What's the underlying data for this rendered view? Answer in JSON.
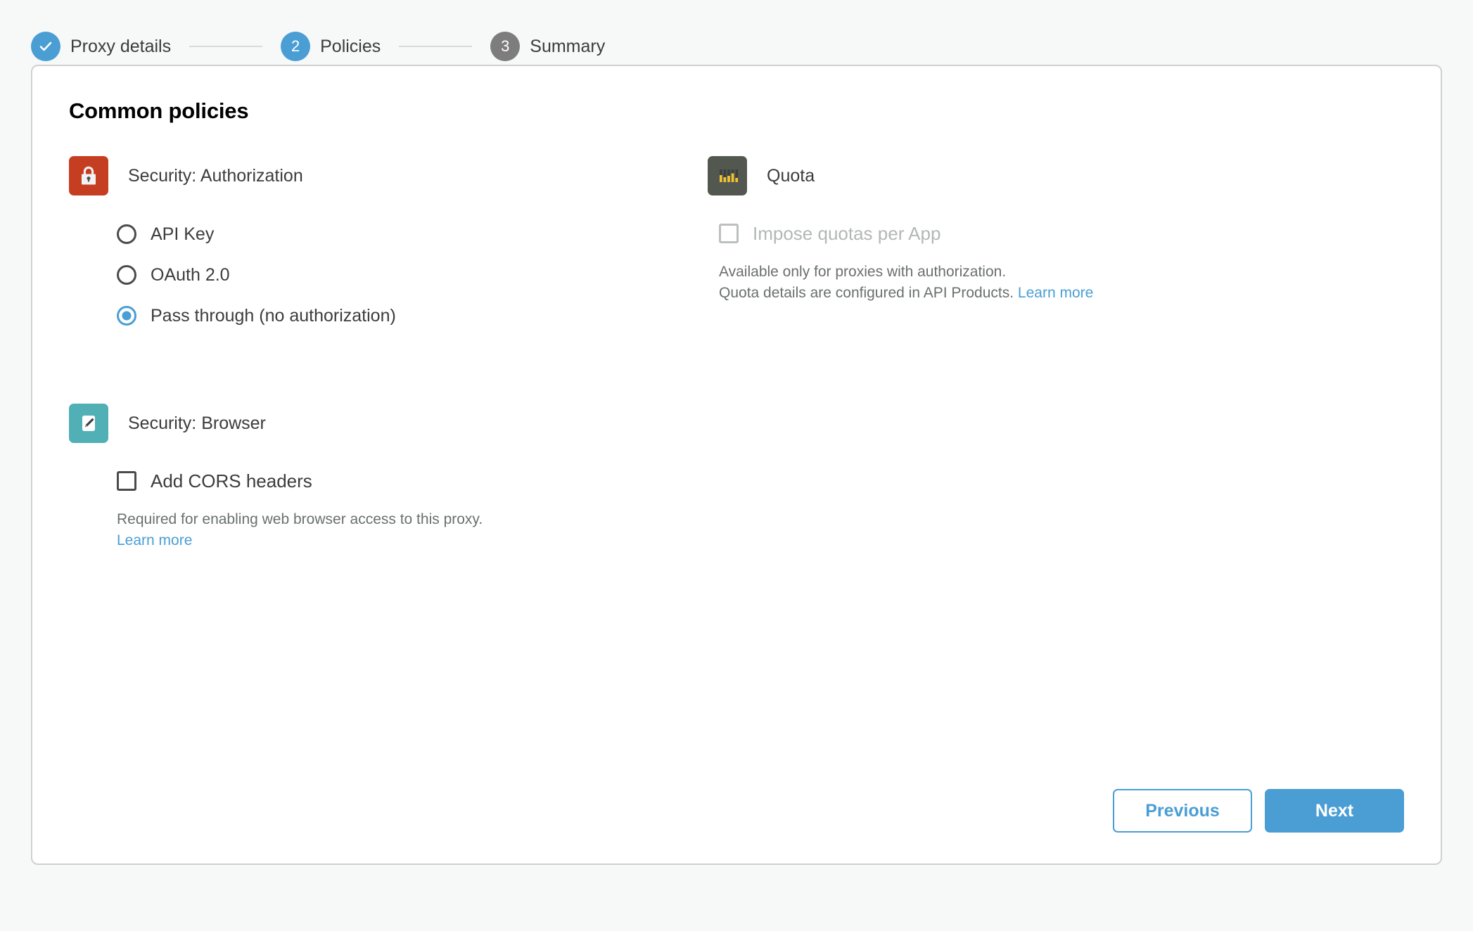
{
  "stepper": {
    "steps": [
      {
        "id": "proxy-details",
        "badge": "check-icon",
        "label": "Proxy details",
        "state": "done"
      },
      {
        "id": "policies",
        "badge": "2",
        "label": "Policies",
        "state": "active"
      },
      {
        "id": "summary",
        "badge": "3",
        "label": "Summary",
        "state": "todo"
      }
    ]
  },
  "card": {
    "title": "Common policies",
    "policies": {
      "security_authorization": {
        "icon": "lock-icon",
        "name": "Security: Authorization",
        "options": [
          {
            "label": "API Key",
            "selected": false
          },
          {
            "label": "OAuth 2.0",
            "selected": false
          },
          {
            "label": "Pass through (no authorization)",
            "selected": true
          }
        ]
      },
      "security_browser": {
        "icon": "pencil-icon",
        "name": "Security: Browser",
        "checkbox_label": "Add CORS headers",
        "checked": false,
        "helper_line1": "Required for enabling web browser access to this proxy.",
        "learn_more": "Learn more"
      },
      "quota": {
        "icon": "quota-bars-icon",
        "name": "Quota",
        "checkbox_label": "Impose quotas per App",
        "checked": false,
        "disabled": true,
        "helper_line1": "Available only for proxies with authorization.",
        "helper_line2": "Quota details are configured in API Products.",
        "learn_more": "Learn more"
      }
    },
    "footer": {
      "previous_label": "Previous",
      "next_label": "Next"
    }
  },
  "colors": {
    "accent": "#4a9ed4",
    "inactive_step": "#7d7d7d",
    "lock_icon_bg": "#c63e21",
    "pencil_icon_bg": "#51b0b5",
    "quota_icon_bg": "#525850",
    "quota_bar": "#f3c230",
    "page_bg": "#f7f8f8"
  }
}
